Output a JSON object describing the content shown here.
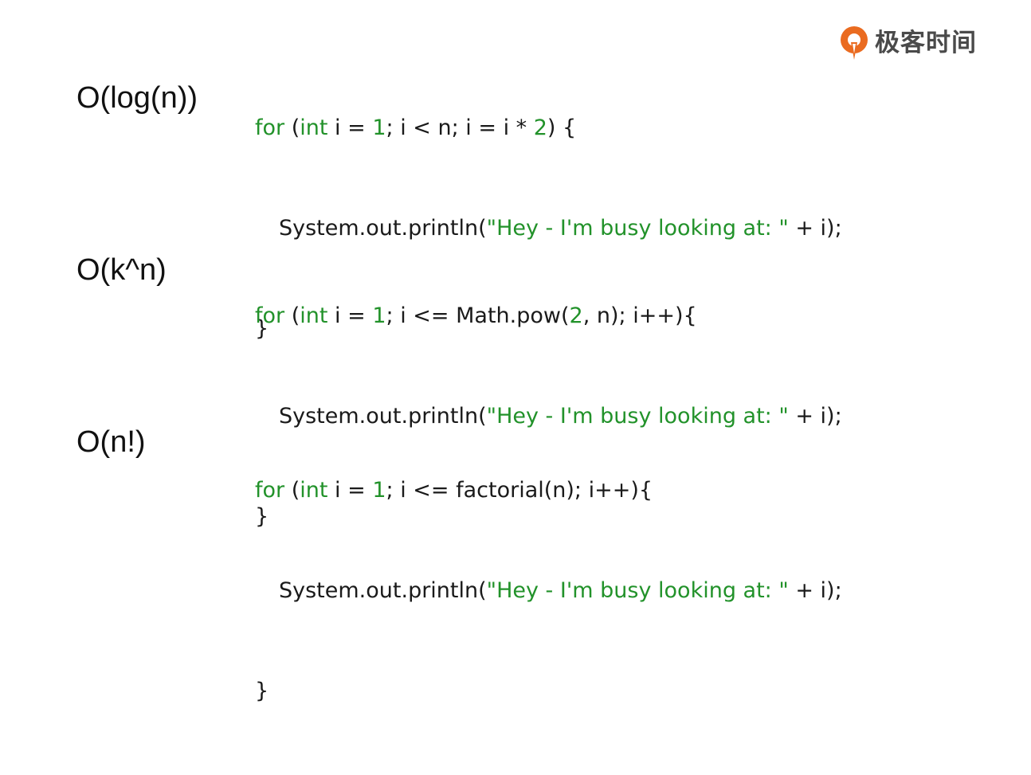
{
  "brand": {
    "name": "极客时间",
    "logo_icon": "geektime-logo-icon",
    "accent_color": "#ea6b20"
  },
  "colors": {
    "keyword": "#22922a",
    "text": "#1a1a1a"
  },
  "examples": [
    {
      "complexity": "O(log(n))",
      "line1": {
        "kw_for": "for",
        "p1": " (",
        "kw_int": "int",
        "p2": " i = ",
        "num1": "1",
        "p3": "; i < n; i = i * ",
        "num2": "2",
        "p4": ") {"
      },
      "line2": {
        "p1": "System.out.println(",
        "str": "\"Hey - I'm busy looking at: \"",
        "p2": " + i);"
      },
      "line3": "}"
    },
    {
      "complexity": "O(k^n)",
      "line1": {
        "kw_for": "for",
        "p1": " (",
        "kw_int": "int",
        "p2": " i = ",
        "num1": "1",
        "p3": "; i <= Math.pow(",
        "num2": "2",
        "p4": ", n); i++){"
      },
      "line2": {
        "p1": "System.out.println(",
        "str": "\"Hey - I'm busy looking at: \"",
        "p2": " + i);"
      },
      "line3": "}"
    },
    {
      "complexity": "O(n!)",
      "line1": {
        "kw_for": "for",
        "p1": " (",
        "kw_int": "int",
        "p2": " i = ",
        "num1": "1",
        "p3": "; i <= factorial(n); i++){"
      },
      "line2": {
        "p1": "System.out.println(",
        "str": "\"Hey - I'm busy looking at: \"",
        "p2": " + i);"
      },
      "line3": "}"
    }
  ]
}
